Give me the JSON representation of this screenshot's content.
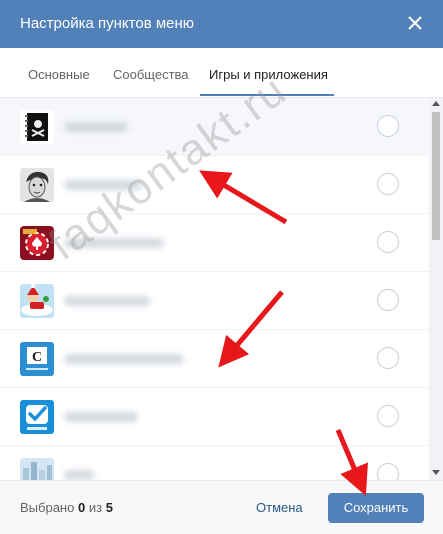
{
  "dialog": {
    "title": "Настройка пунктов меню"
  },
  "tabs": [
    {
      "label": "Основные",
      "active": false
    },
    {
      "label": "Сообщества",
      "active": false
    },
    {
      "label": "Игры и приложения",
      "active": true
    }
  ],
  "apps": [
    {
      "icon": "notebook-skull-icon",
      "checked": false
    },
    {
      "icon": "sketch-portrait-icon",
      "checked": false
    },
    {
      "icon": "poker-chip-icon",
      "checked": false
    },
    {
      "icon": "santa-sleigh-icon",
      "checked": false
    },
    {
      "icon": "letter-c-icon",
      "checked": false
    },
    {
      "icon": "magic-test-icon",
      "checked": false
    },
    {
      "icon": "city-photo-icon",
      "checked": false
    }
  ],
  "footer": {
    "selected_prefix": "Выбрано",
    "selected_count": "0",
    "selected_of": "из",
    "selected_total": "5",
    "cancel_label": "Отмена",
    "save_label": "Сохранить"
  },
  "watermark": "faqkontakt.ru",
  "colors": {
    "header": "#5181b8",
    "accent": "#5181b8",
    "link": "#2a5885",
    "annotation_arrow": "#e8171c"
  }
}
